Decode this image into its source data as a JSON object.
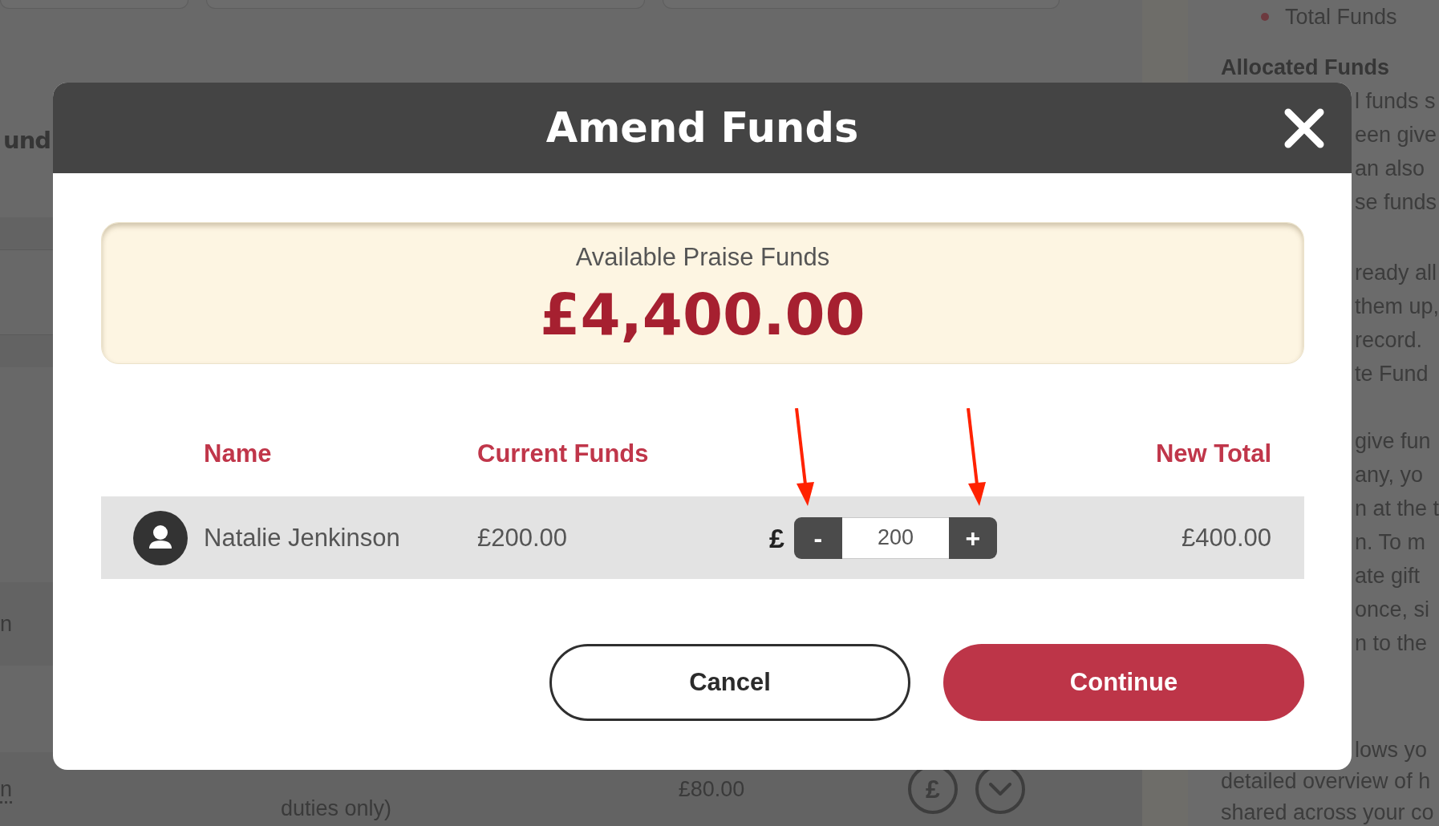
{
  "page": {
    "heading_fragment": "und",
    "table": {
      "rows": [
        {
          "name_fragment": "n",
          "link": false
        },
        {
          "name_fragment": "n",
          "link": true,
          "role_lines": [
            "duties only)"
          ],
          "current_funds": "£80.00",
          "actions": [
            {
              "kind": "pound",
              "symbol": "£"
            },
            {
              "kind": "expand"
            }
          ]
        }
      ]
    }
  },
  "sidebar": {
    "list_items": [
      "Total Funds"
    ],
    "heading": "Allocated Funds",
    "paragraphs": [
      [
        {
          "text": "l funds s",
          "covered": true
        },
        {
          "text": "een give",
          "covered": true
        },
        {
          "text": "an also",
          "covered": true
        },
        {
          "text": "se funds",
          "covered": true
        }
      ],
      [
        {
          "text": "ready all",
          "covered": true
        },
        {
          "text": "them up,",
          "covered": true
        },
        {
          "text": "record.",
          "covered": true
        },
        {
          "text": "te Fund",
          "covered": true
        }
      ],
      [
        {
          "text": "give fun",
          "covered": true
        },
        {
          "text": "any, yo",
          "covered": true
        },
        {
          "text": "n at the t",
          "covered": true
        },
        {
          "text": "n. To m",
          "covered": true
        },
        {
          "text": "ate gift",
          "covered": true
        },
        {
          "text": "once, si",
          "covered": true
        },
        {
          "text": "n to the",
          "covered": true
        }
      ],
      [
        {
          "text": "lows yo",
          "covered": true
        },
        {
          "text": "detailed overview of h",
          "covered": false
        },
        {
          "text": "shared across your co",
          "covered": false
        }
      ]
    ]
  },
  "modal": {
    "title": "Amend Funds",
    "available": {
      "label": "Available Praise Funds",
      "amount": "£4,400.00"
    },
    "table": {
      "columns": [
        "Name",
        "Current Funds",
        "New Total"
      ],
      "rows": [
        {
          "name": "Natalie Jenkinson",
          "current_funds": "£200.00",
          "currency": "£",
          "decrement": "-",
          "amount": "200",
          "increment": "+",
          "new_total": "£400.00"
        }
      ]
    },
    "buttons": [
      {
        "label": "Cancel",
        "kind": "secondary"
      },
      {
        "label": "Continue",
        "kind": "primary"
      }
    ]
  }
}
